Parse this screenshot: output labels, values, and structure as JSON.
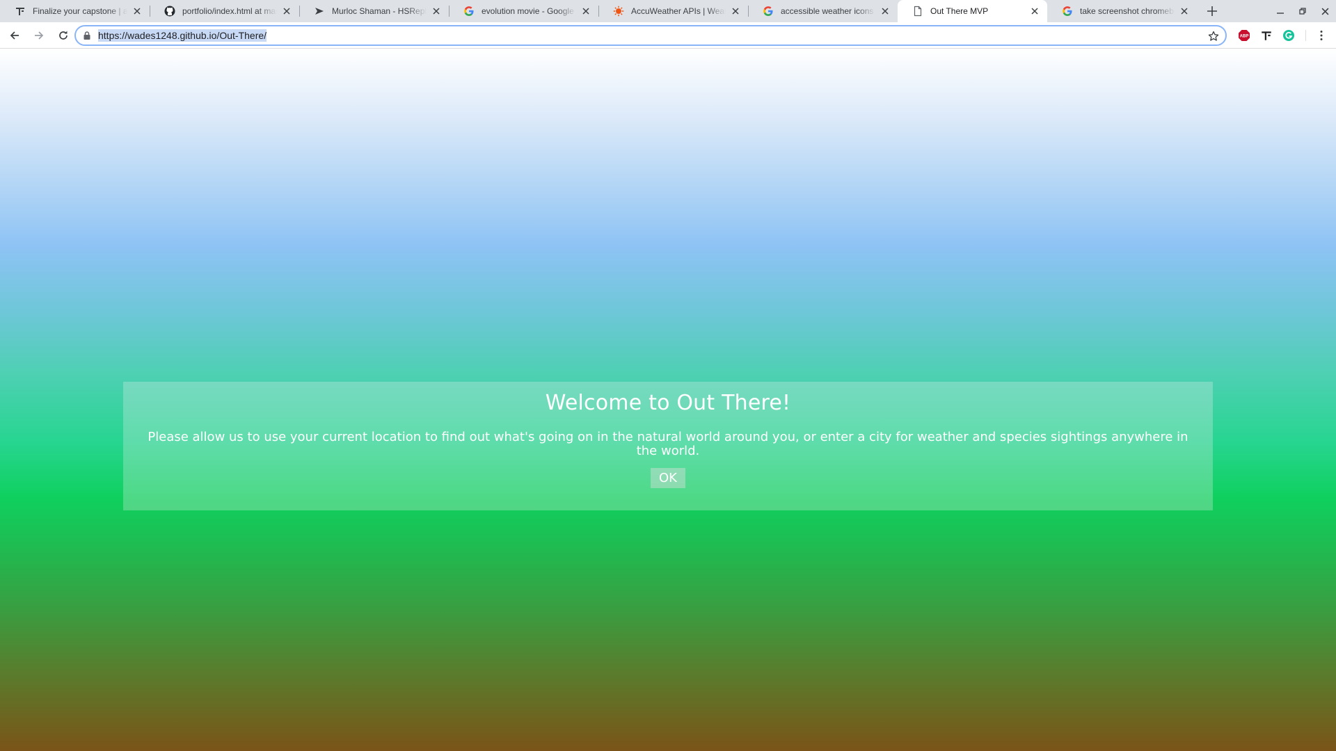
{
  "browser": {
    "tabs": [
      {
        "title": "Finalize your capstone | api-h",
        "favicon": "thinkful-icon",
        "active": false
      },
      {
        "title": "portfolio/index.html at mast",
        "favicon": "github-icon",
        "active": false
      },
      {
        "title": "Murloc Shaman - HSReplay.n",
        "favicon": "hsreplay-icon",
        "active": false
      },
      {
        "title": "evolution movie - Google Sea",
        "favicon": "google-icon",
        "active": false
      },
      {
        "title": "AccuWeather APIs | Weather",
        "favicon": "accuweather-icon",
        "active": false
      },
      {
        "title": "accessible weather icons - Go",
        "favicon": "google-icon",
        "active": false
      },
      {
        "title": "Out There MVP",
        "favicon": "page-icon",
        "active": true
      },
      {
        "title": "take screenshot chromebook",
        "favicon": "google-icon",
        "active": false
      }
    ],
    "url": "https://wades1248.github.io/Out-There/"
  },
  "modal": {
    "title": "Welcome to Out There!",
    "message": "Please allow us to use your current location to find out what's going on in the natural world around you, or enter a city for weather and species sightings anywhere in the world.",
    "ok_label": "OK"
  },
  "colors": {
    "tab_strip": "#dee1e6",
    "omnibox_focus": "#8ab4f8",
    "abp_red": "#c8102e",
    "grammarly_green": "#15c39a",
    "accuweather_orange": "#f05514"
  }
}
